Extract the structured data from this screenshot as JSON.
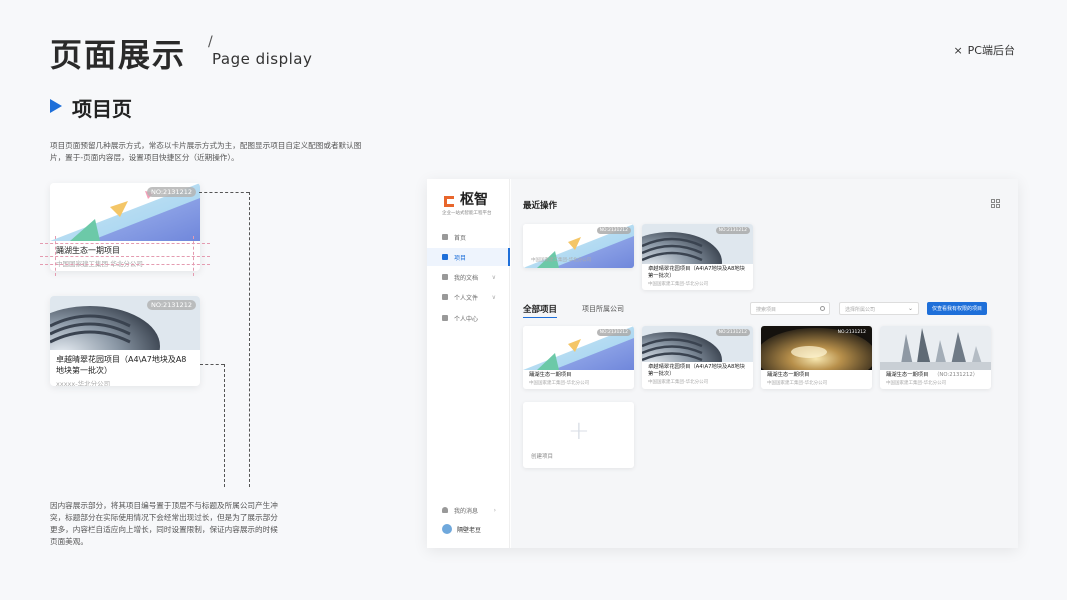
{
  "header": {
    "title": "页面展示",
    "slash": "/",
    "subtitle": "Page display",
    "platform": "PC端后台",
    "platform_mark": "×"
  },
  "section": {
    "title": "项目页",
    "description": "项目页面预留几种展示方式，常态以卡片展示方式为主，配图显示项目自定义配图或者默认图片，置于-页面内容层，设置项目快捷区分（近期操作）。",
    "note": "因内容展示部分，将其项目编号置于顶层不与标题及所属公司产生冲突，标题部分在实际使用情况下会经常出现过长，但是为了展示部分更多，内容栏自适应向上增长，同时设置限制，保证内容展示的时候页面美观。"
  },
  "sample_cards": [
    {
      "badge": "NO:2131212",
      "name": "踊湖生态一期项目",
      "company": "中国国家建工集团-华北分公司"
    },
    {
      "badge": "NO:2131212",
      "name": "卓越晴翠花园项目（A4\\A7地块及A8地块第一批次）",
      "company": "xxxxx-华北分公司"
    }
  ],
  "app": {
    "logo_text": "枢智",
    "logo_sub": "企业一站式智能工程平台",
    "menu": [
      {
        "label": "首页",
        "icon": "home-icon",
        "active": false,
        "chevron": ""
      },
      {
        "label": "项目",
        "icon": "project-icon",
        "active": true,
        "chevron": ""
      },
      {
        "label": "我的文档",
        "icon": "document-icon",
        "active": false,
        "chevron": "∨"
      },
      {
        "label": "个人文件",
        "icon": "person-file-icon",
        "active": false,
        "chevron": "∨"
      },
      {
        "label": "个人中心",
        "icon": "person-icon",
        "active": false,
        "chevron": ""
      }
    ],
    "messages_label": "我的消息",
    "messages_chevron": "›",
    "user_name": "隔壁老豆",
    "recent_title": "最近操作",
    "all_tab": "全部项目",
    "company_tab": "项目所属公司",
    "search_placeholder": "搜索项目",
    "select_placeholder": "选择所属公司",
    "only_mine_button": "仅查看我有权限的项目",
    "create_label": "创建项目",
    "recent_cards": [
      {
        "badge": "NO:2131212",
        "name": "",
        "company": "中国国家建工集团-华北分公司",
        "thumb": "triangles"
      },
      {
        "badge": "NO:2131212",
        "name": "卓越晴翠花园项目（A4\\A7地块及A8地块第一批次）",
        "company": "中国国家建工集团-华北分公司",
        "thumb": "pipe"
      }
    ],
    "all_cards": [
      {
        "badge": "NO:2131212",
        "name": "踊湖生态一期项目",
        "company": "中国国家建工集团-华北分公司",
        "thumb": "triangles"
      },
      {
        "badge": "NO:2131212",
        "name": "卓越晴翠花园项目（A4\\A7地块及A8地块第一批次）",
        "company": "中国国家建工集团-华北分公司",
        "thumb": "pipe"
      },
      {
        "badge": "NO:2131212",
        "name": "踊湖生态一期项目",
        "company": "中国国家建工集团-华北分公司",
        "thumb": "lens"
      },
      {
        "badge": "（NO:2131212）",
        "name": "踊湖生态一期项目",
        "company": "中国国家建工集团-华北分公司",
        "thumb": "city"
      }
    ]
  },
  "colors": {
    "accent": "#1e6fd9",
    "logo_orange": "#e8662c"
  }
}
